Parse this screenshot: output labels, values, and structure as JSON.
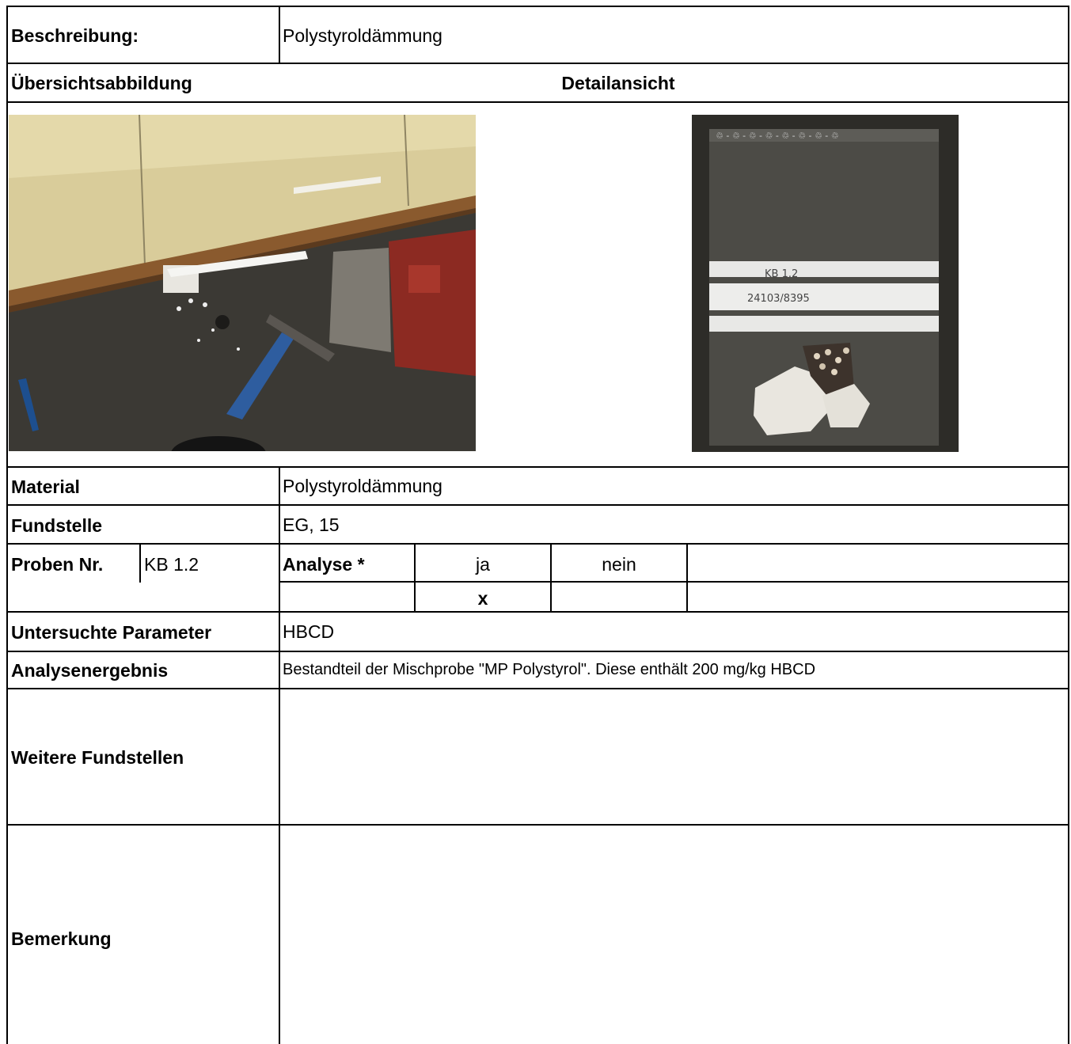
{
  "beschreibung": {
    "label": "Beschreibung:",
    "value": "Polystyroldämmung"
  },
  "headers": {
    "uebersicht": "Übersichtsabbildung",
    "detail": "Detailansicht"
  },
  "photos": {
    "overview": {
      "icon": "overview-photo"
    },
    "detail": {
      "icon": "sample-bag-photo",
      "bag_label_1": "KB 1.2",
      "bag_label_2": "24103/8395"
    }
  },
  "material": {
    "label": "Material",
    "value": "Polystyroldämmung"
  },
  "fundstelle": {
    "label": "Fundstelle",
    "value": "EG, 15"
  },
  "probe": {
    "label": "Proben Nr.",
    "value": "KB 1.2",
    "analyse_label": "Analyse *",
    "ja_label": "ja",
    "nein_label": "nein",
    "ja_mark": "x",
    "nein_mark": ""
  },
  "parameter": {
    "label": "Untersuchte Parameter",
    "value": "HBCD"
  },
  "ergebnis": {
    "label": "Analysenergebnis",
    "value": "Bestandteil der Mischprobe \"MP Polystyrol\". Diese enthält 200 mg/kg HBCD"
  },
  "weitere": {
    "label": "Weitere Fundstellen",
    "value": ""
  },
  "bemerkung": {
    "label": "Bemerkung",
    "value": ""
  }
}
